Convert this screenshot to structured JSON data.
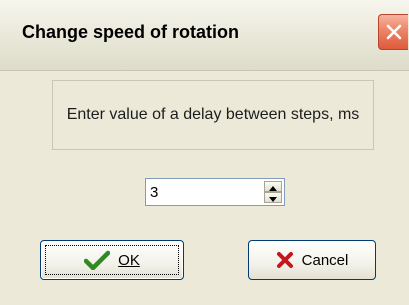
{
  "window": {
    "title": "Change speed of rotation"
  },
  "message": {
    "text": "Enter value of a delay between steps, ms"
  },
  "delay": {
    "value": "3"
  },
  "buttons": {
    "ok_label": "OK",
    "cancel_label": "Cancel"
  },
  "icons": {
    "close": "close-icon",
    "ok": "checkmark-icon",
    "cancel": "x-icon",
    "spin_up": "arrow-up-icon",
    "spin_down": "arrow-down-icon"
  },
  "colors": {
    "checkmark": "#2e8b1f",
    "cancel_x": "#c4161c",
    "close_button": "#de5a3b"
  }
}
